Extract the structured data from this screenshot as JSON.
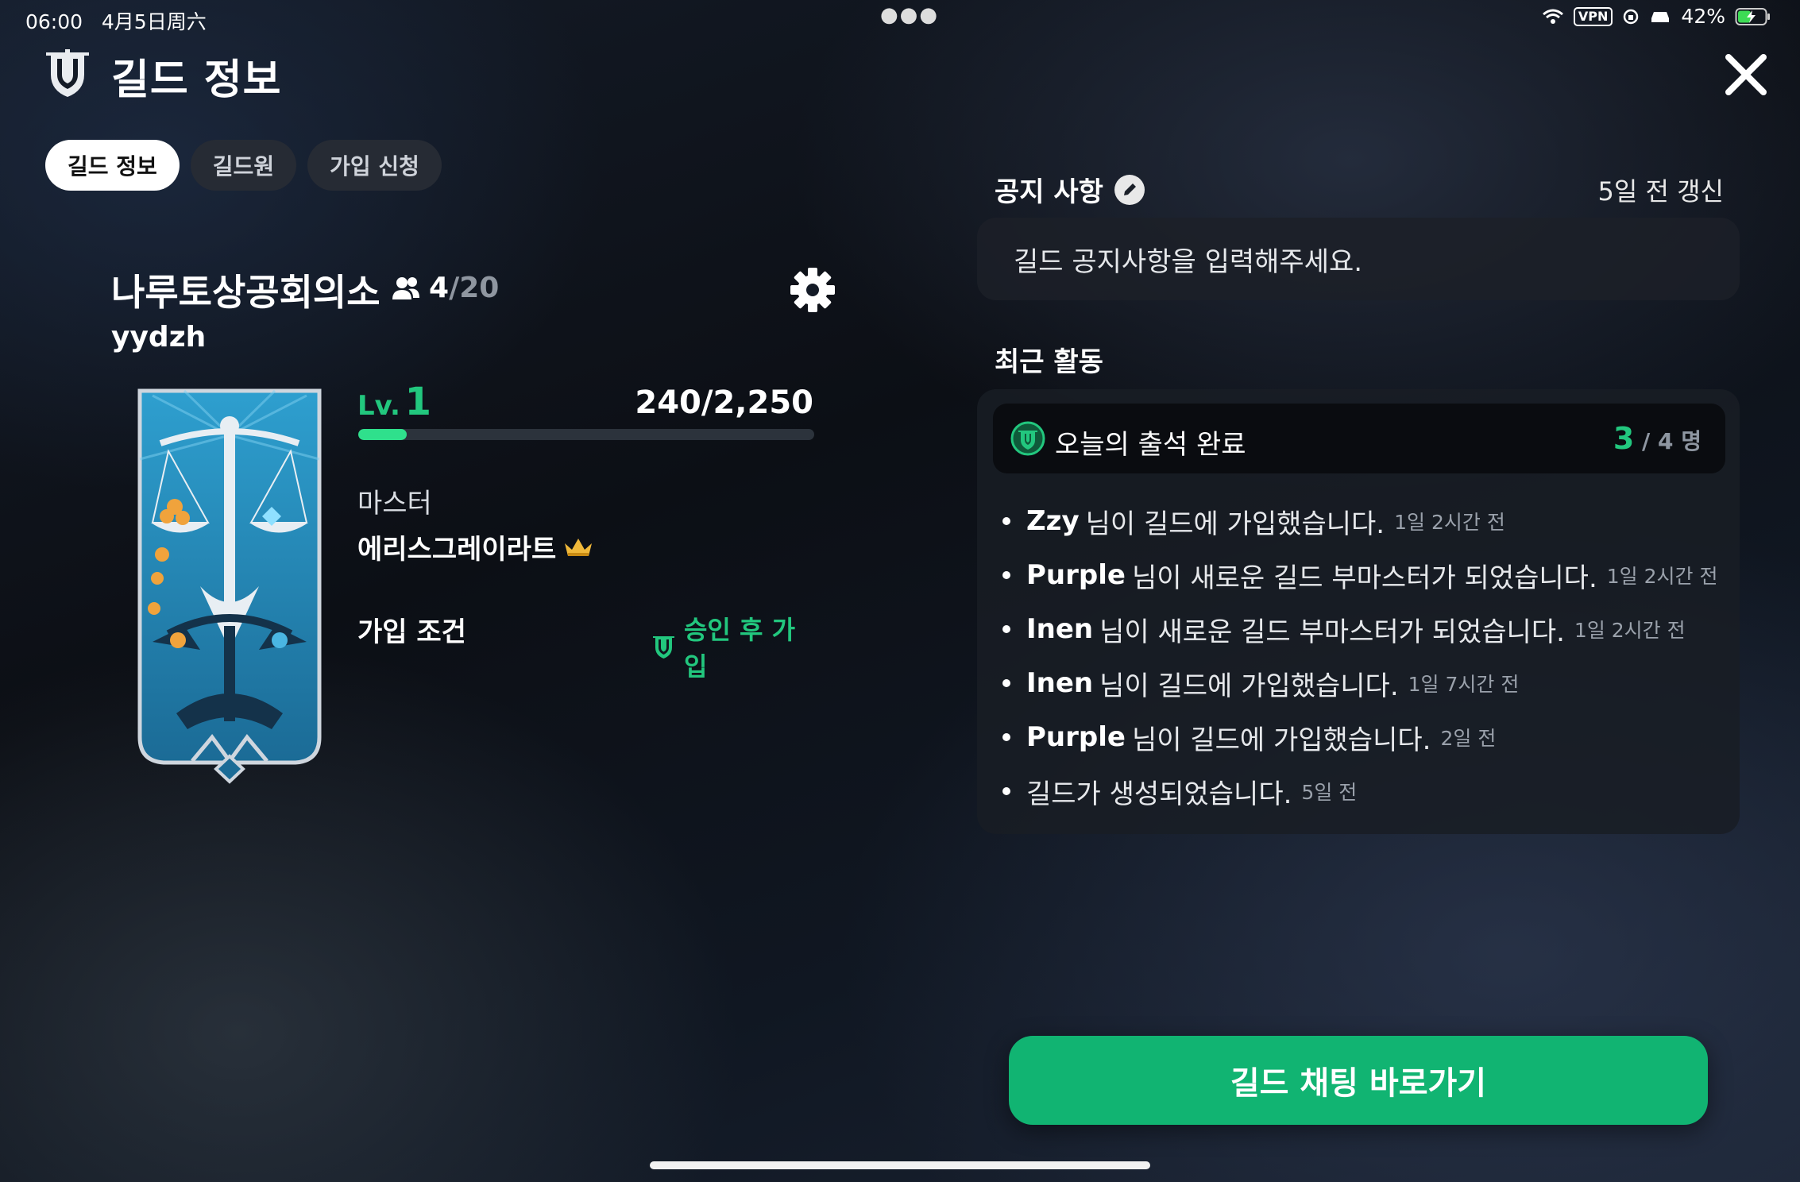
{
  "status_bar": {
    "time": "06:00",
    "date": "4月5日周六",
    "vpn": "VPN",
    "battery": "42%"
  },
  "header": {
    "title": "길드 정보"
  },
  "tabs": [
    {
      "label": "길드 정보",
      "active": true
    },
    {
      "label": "길드원",
      "active": false
    },
    {
      "label": "가입 신청",
      "active": false
    }
  ],
  "guild": {
    "name": "나루토상공회의소",
    "members_current": "4",
    "members_max": "/20",
    "id": "yydzh",
    "level_label": "Lv.",
    "level": "1",
    "xp_current": "240",
    "xp_max": "/2,250",
    "xp_fraction": 0.107,
    "master_label": "마스터",
    "master_name": "에리스그레이라트",
    "join_label": "가입 조건",
    "join_value": "승인 후 가입"
  },
  "notice": {
    "label": "공지 사항",
    "updated": "5일 전 갱신",
    "placeholder": "길드 공지사항을 입력해주세요."
  },
  "recent": {
    "label": "최근 활동",
    "attendance_text": "오늘의 출석 완료",
    "attendance_current": "3",
    "attendance_rest": " / 4 명",
    "items": [
      {
        "who": "Zzy",
        "text": "님이 길드에 가입했습니다.",
        "when": "1일 2시간 전"
      },
      {
        "who": "Purple",
        "text": "님이 새로운 길드 부마스터가 되었습니다.",
        "when": "1일 2시간 전"
      },
      {
        "who": "Inen",
        "text": "님이 새로운 길드 부마스터가 되었습니다.",
        "when": "1일 2시간 전"
      },
      {
        "who": "Inen",
        "text": "님이 길드에 가입했습니다.",
        "when": "1일 7시간 전"
      },
      {
        "who": "Purple",
        "text": "님이 길드에 가입했습니다.",
        "when": "2일 전"
      },
      {
        "who": "",
        "text": "길드가 생성되었습니다.",
        "when": "5일 전"
      }
    ]
  },
  "chat_button": {
    "label": "길드 채팅 바로가기"
  },
  "colors": {
    "accent_green": "#22c77e",
    "button_green": "#11b472",
    "xp_fill": "#2fe08c"
  },
  "icons": [
    "guild-shield-icon",
    "close-icon",
    "members-icon",
    "gear-icon",
    "crown-icon",
    "edit-icon",
    "attendance-icon",
    "wifi-icon",
    "battery-icon"
  ]
}
